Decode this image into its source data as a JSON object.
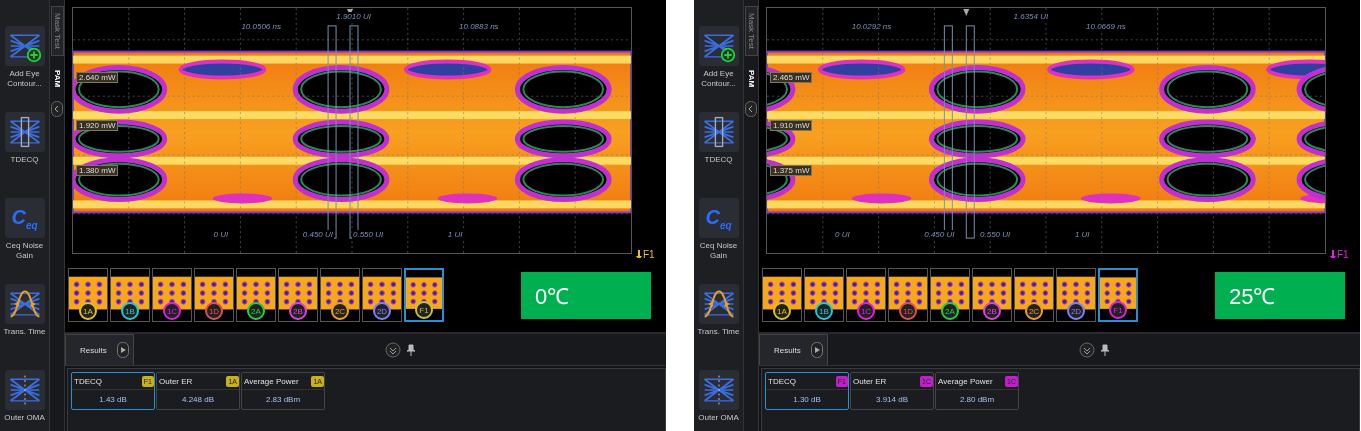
{
  "panels": [
    {
      "sidebar": {
        "items": [
          {
            "label": "Add Eye Contour...",
            "kind": "contour"
          },
          {
            "label": "TDECQ",
            "kind": "tdecq"
          },
          {
            "label": "Ceq Noise Gain",
            "kind": "ceq",
            "icon_text": "C$_{eq}$"
          },
          {
            "label": "Trans. Time",
            "kind": "trans"
          },
          {
            "label": "Outer OMA",
            "kind": "oma"
          }
        ]
      },
      "vertical_tabs": [
        {
          "label": "Mask Test",
          "selected": false
        },
        {
          "label": "PAM",
          "selected": true
        }
      ],
      "plot": {
        "top_labels": [
          "10.0506 ns",
          "1.9010 UI",
          "10.0883 ns"
        ],
        "level_labels": [
          "2.640 mW",
          "1.920 mW",
          "1.380 mW"
        ],
        "bottom_labels": [
          "0 UI",
          "0.450 UI",
          "0.550 UI",
          "1 UI"
        ],
        "marker": {
          "label": "F1",
          "color": "#e8c020"
        }
      },
      "thumbnails": [
        {
          "label": "1A",
          "color": "#e0c020",
          "selected": false
        },
        {
          "label": "1B",
          "color": "#20c8d8",
          "selected": false
        },
        {
          "label": "1C",
          "color": "#e020e0",
          "selected": false
        },
        {
          "label": "1D",
          "color": "#e05050",
          "selected": false
        },
        {
          "label": "2A",
          "color": "#20d040",
          "selected": false
        },
        {
          "label": "2B",
          "color": "#e040e0",
          "selected": false
        },
        {
          "label": "2C",
          "color": "#f0a020",
          "selected": false
        },
        {
          "label": "2D",
          "color": "#8080ff",
          "selected": false
        },
        {
          "label": "F1",
          "color": "#c8c040",
          "selected": true
        }
      ],
      "temperature": "0℃",
      "results": {
        "tab": "Results",
        "measurements": [
          {
            "name": "TDECQ",
            "source": "F1",
            "color": "#c8b020",
            "value": "1.43 dB",
            "selected": true
          },
          {
            "name": "Outer ER",
            "source": "1A",
            "color": "#c8b020",
            "value": "4.248 dB",
            "selected": false
          },
          {
            "name": "Average Power",
            "source": "1A",
            "color": "#c8b020",
            "value": "2.83 dBm",
            "selected": false
          }
        ]
      }
    },
    {
      "sidebar": {
        "items": [
          {
            "label": "Add Eye Contour...",
            "kind": "contour"
          },
          {
            "label": "TDECQ",
            "kind": "tdecq"
          },
          {
            "label": "Ceq Noise Gain",
            "kind": "ceq",
            "icon_text": "C$_{eq}$"
          },
          {
            "label": "Trans. Time",
            "kind": "trans"
          },
          {
            "label": "Outer OMA",
            "kind": "oma"
          }
        ]
      },
      "vertical_tabs": [
        {
          "label": "Mask Test",
          "selected": false
        },
        {
          "label": "PAM",
          "selected": true
        }
      ],
      "plot": {
        "top_labels": [
          "10.0292 ns",
          "1.6354 UI",
          "10.0669 ns"
        ],
        "level_labels": [
          "2.465 mW",
          "1.910 mW",
          "1.375 mW"
        ],
        "bottom_labels": [
          "0 UI",
          "0.450 UI",
          "0.550 UI",
          "1 UI"
        ],
        "marker": {
          "label": "F1",
          "color": "#e020e0"
        }
      },
      "thumbnails": [
        {
          "label": "1A",
          "color": "#e0c020",
          "selected": false
        },
        {
          "label": "1B",
          "color": "#20c8d8",
          "selected": false
        },
        {
          "label": "1C",
          "color": "#e020e0",
          "selected": false
        },
        {
          "label": "1D",
          "color": "#e05050",
          "selected": false
        },
        {
          "label": "2A",
          "color": "#20d040",
          "selected": false
        },
        {
          "label": "2B",
          "color": "#e040e0",
          "selected": false
        },
        {
          "label": "2C",
          "color": "#f0a020",
          "selected": false
        },
        {
          "label": "2D",
          "color": "#8080ff",
          "selected": false
        },
        {
          "label": "F1",
          "color": "#e020e0",
          "selected": true
        }
      ],
      "temperature": "25℃",
      "results": {
        "tab": "Results",
        "measurements": [
          {
            "name": "TDECQ",
            "source": "F1",
            "color": "#c020c8",
            "value": "1.30 dB",
            "selected": true
          },
          {
            "name": "Outer ER",
            "source": "1C",
            "color": "#c020c8",
            "value": "3.914 dB",
            "selected": false
          },
          {
            "name": "Average Power",
            "source": "1C",
            "color": "#c020c8",
            "value": "2.80 dBm",
            "selected": false
          }
        ]
      }
    }
  ]
}
